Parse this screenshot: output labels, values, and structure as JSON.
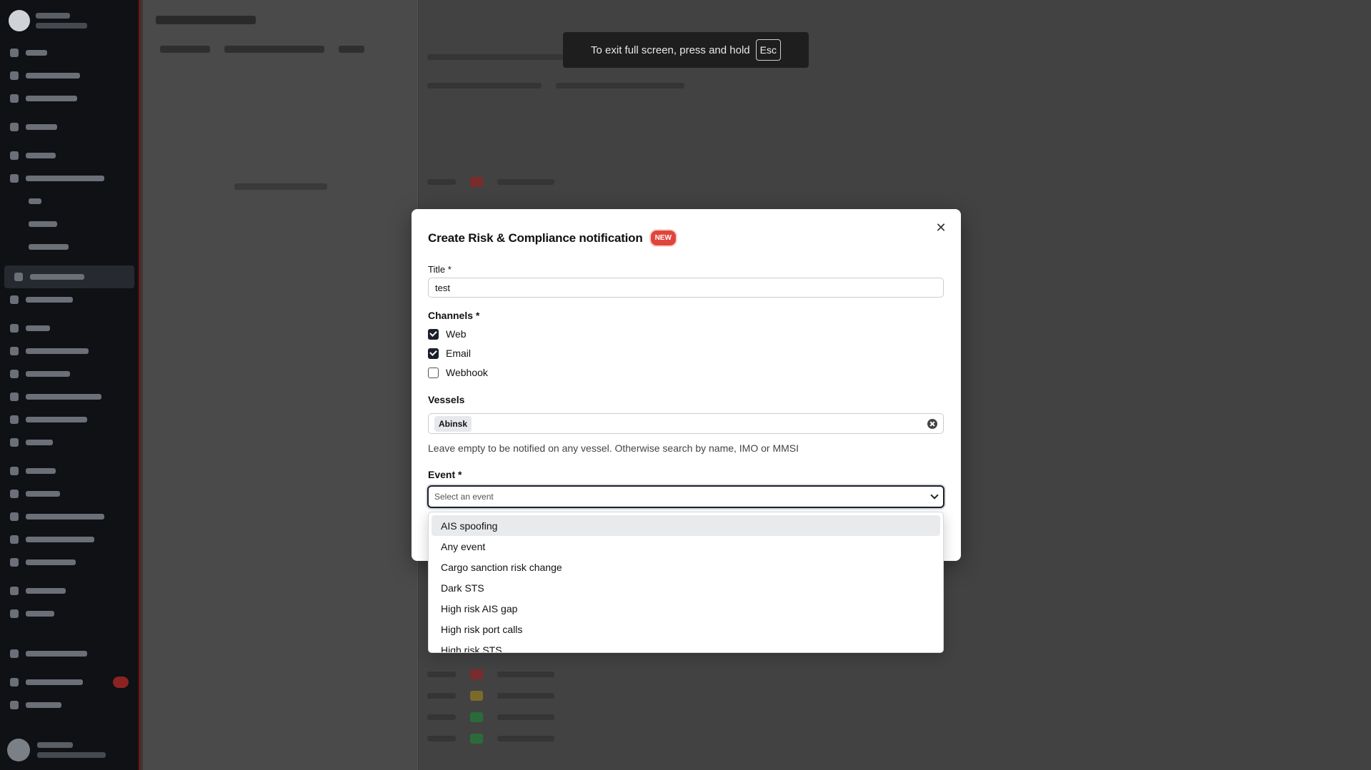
{
  "fullscreen_toast": {
    "message": "To exit full screen, press and hold",
    "key": "Esc"
  },
  "modal": {
    "title": "Create Risk & Compliance notification",
    "badge": "NEW",
    "title_field": {
      "label": "Title *",
      "value": "test"
    },
    "channels": {
      "label": "Channels *",
      "options": [
        {
          "label": "Web",
          "checked": true
        },
        {
          "label": "Email",
          "checked": true
        },
        {
          "label": "Webhook",
          "checked": false
        }
      ]
    },
    "vessels": {
      "label": "Vessels",
      "selected": [
        "Abinsk"
      ],
      "helper": "Leave empty to be notified on any vessel. Otherwise search by name, IMO or MMSI"
    },
    "event": {
      "label": "Event *",
      "placeholder": "Select an event",
      "options": [
        "AIS spoofing",
        "Any event",
        "Cargo sanction risk change",
        "Dark STS",
        "High risk AIS gap",
        "High risk port calls",
        "High risk STS"
      ],
      "highlighted_index": 0
    }
  },
  "colors": {
    "accent": "#1a1f2b",
    "badge_red": "#e0453b"
  }
}
